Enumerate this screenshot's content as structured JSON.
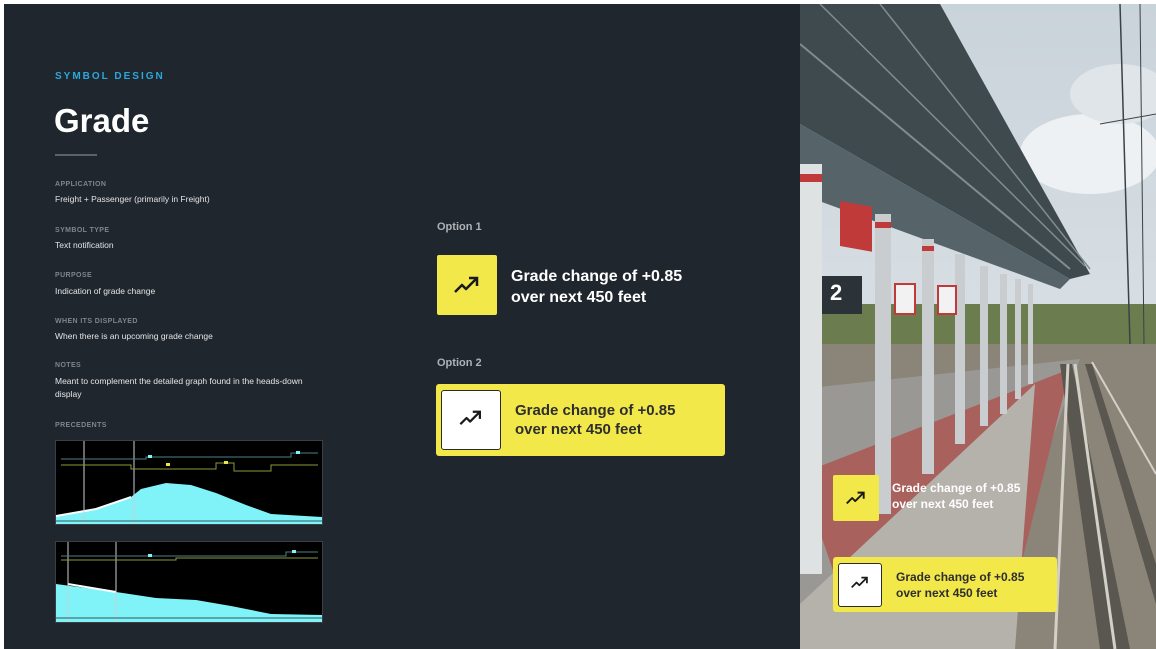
{
  "header": {
    "eyebrow": "SYMBOL DESIGN",
    "title": "Grade"
  },
  "meta": [
    {
      "label": "APPLICATION",
      "value": "Freight + Passenger (primarily in Freight)"
    },
    {
      "label": "SYMBOL TYPE",
      "value": "Text notification"
    },
    {
      "label": "PURPOSE",
      "value": "Indication of grade change"
    },
    {
      "label": "WHEN ITS DISPLAYED",
      "value": "When there is an upcoming grade change"
    },
    {
      "label": "NOTES",
      "value": "Meant to complement the detailed graph found in the heads-down display"
    }
  ],
  "precedents": {
    "label": "PRECEDENTS"
  },
  "options": {
    "option1": {
      "label": "Option 1",
      "line1": "Grade change of +0.85",
      "line2": "over next 450 feet",
      "icon": "trending-up-icon"
    },
    "option2": {
      "label": "Option 2",
      "line1": "Grade change of +0.85",
      "line2": "over next 450 feet",
      "icon": "trending-up-icon"
    }
  },
  "photo_overlay": {
    "notice1": {
      "line1": "Grade change of +0.85",
      "line2": "over next 450 feet"
    },
    "notice2": {
      "line1": "Grade change of +0.85",
      "line2": "over next 450 feet"
    },
    "platform_number": "2"
  },
  "colors": {
    "background": "#20262d",
    "accent": "#2ba7dd",
    "notice_yellow": "#f2e84a",
    "graph_fill": "#7ff3f7"
  }
}
